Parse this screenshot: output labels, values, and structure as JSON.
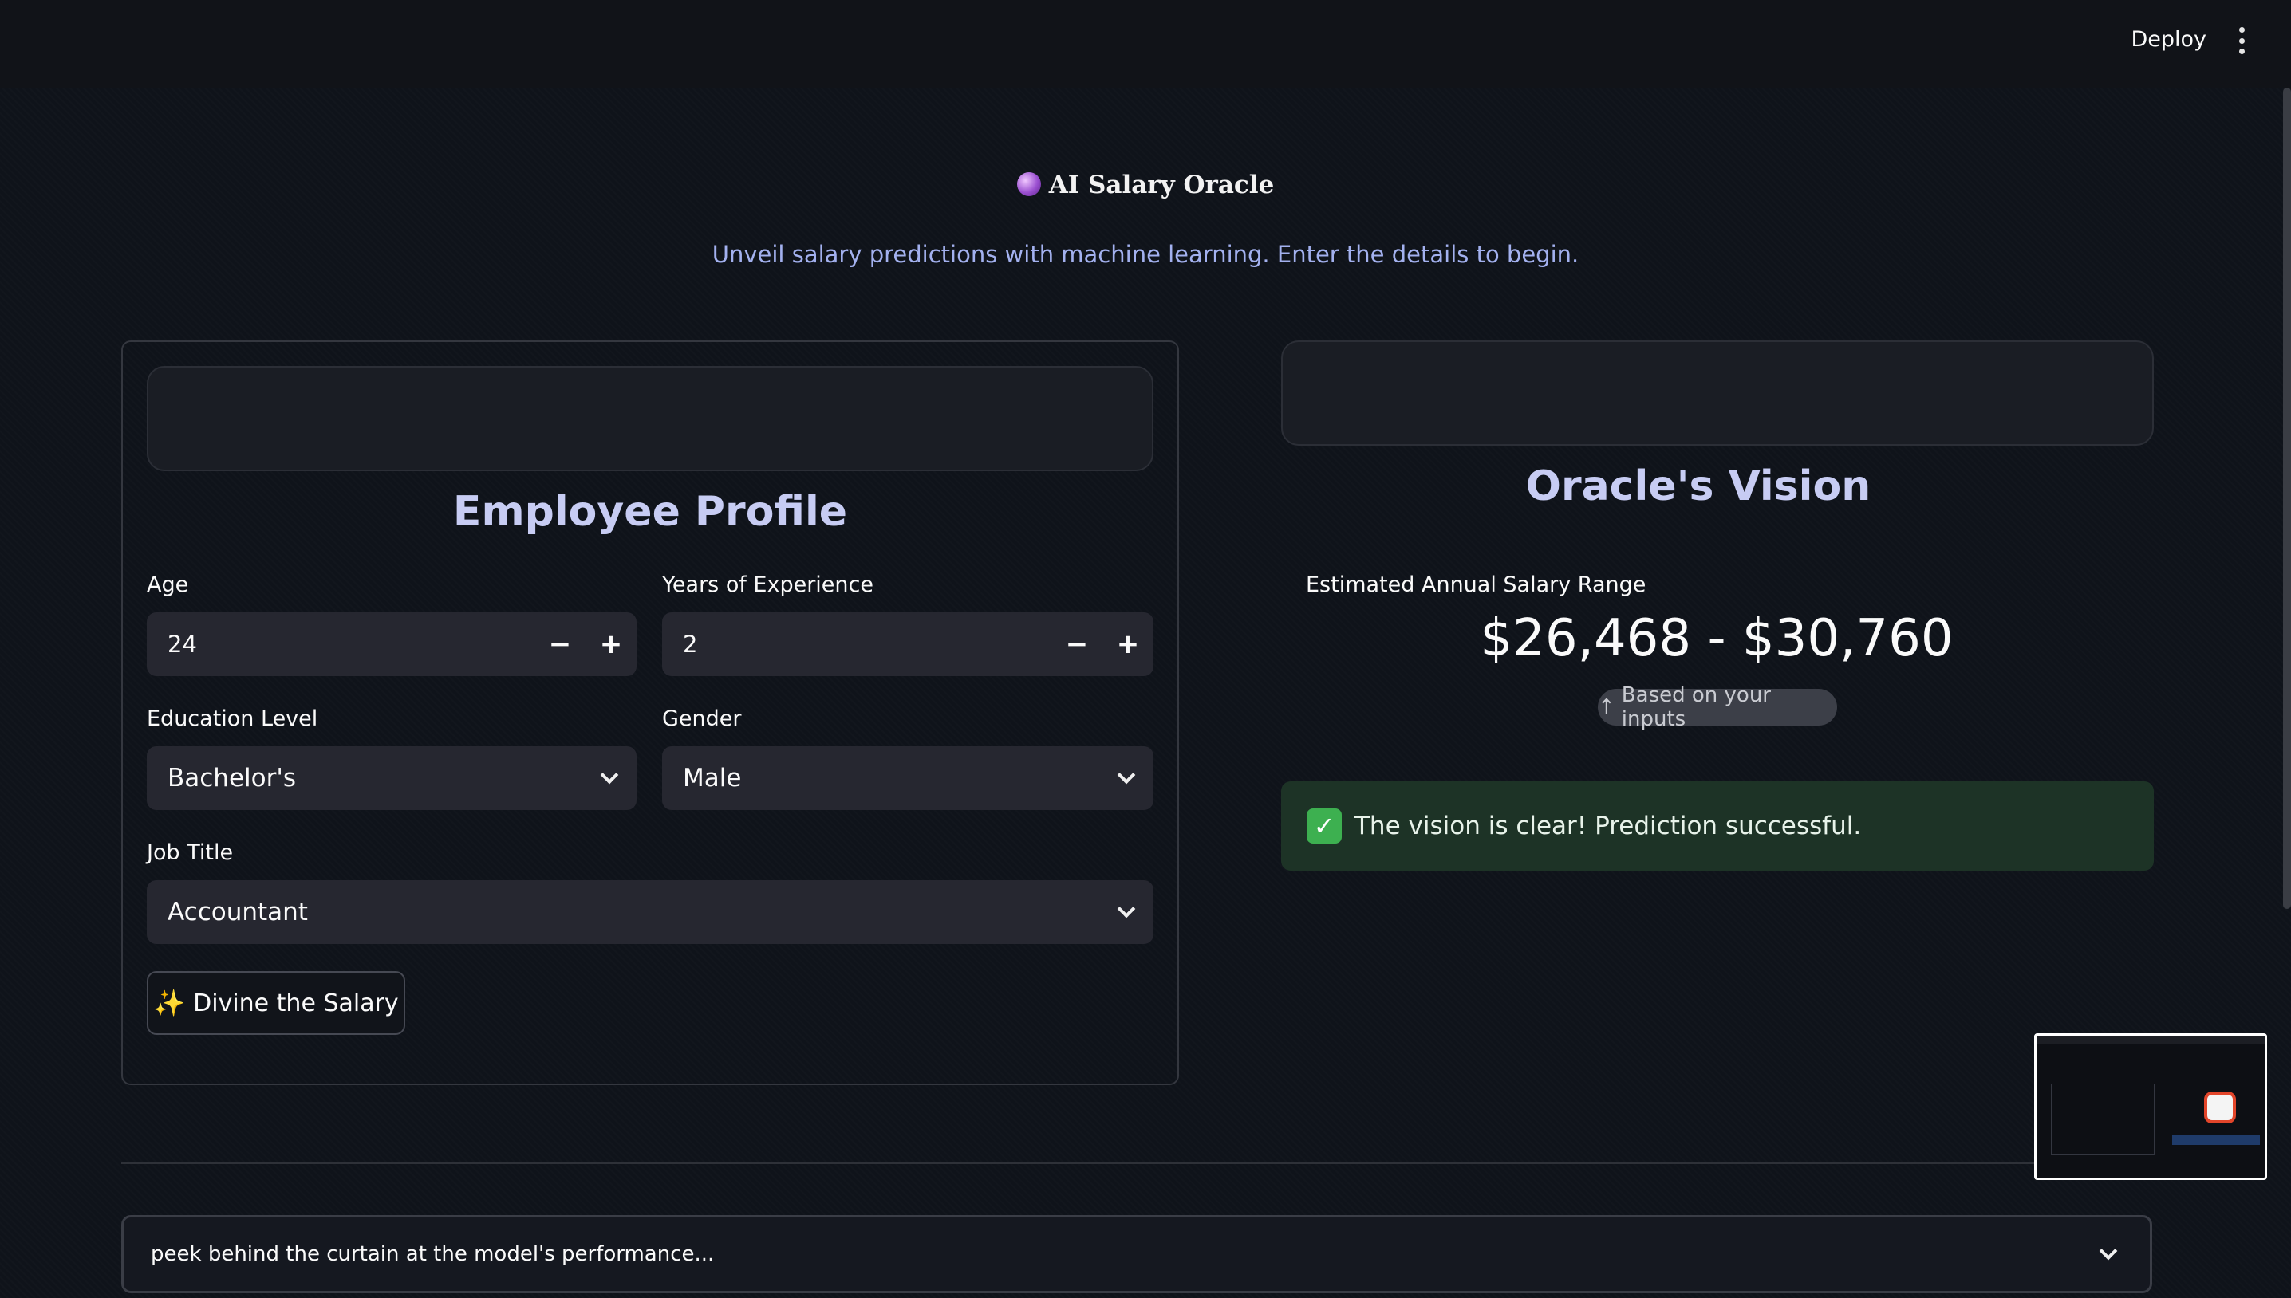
{
  "header": {
    "deploy_label": "Deploy",
    "menu_icon": "kebab-menu-icon"
  },
  "hero": {
    "title": "AI Salary Oracle",
    "title_icon": "crystal-ball-icon",
    "subtitle": "Unveil salary predictions with machine learning. Enter the details to begin."
  },
  "profile": {
    "heading": "Employee Profile",
    "age": {
      "label": "Age",
      "value": "24"
    },
    "experience": {
      "label": "Years of Experience",
      "value": "2"
    },
    "education": {
      "label": "Education Level",
      "value": "Bachelor's"
    },
    "gender": {
      "label": "Gender",
      "value": "Male"
    },
    "job_title": {
      "label": "Job Title",
      "value": "Accountant"
    },
    "submit_label": "Divine the Salary",
    "submit_icon": "sparkles-icon"
  },
  "vision": {
    "heading": "Oracle's Vision",
    "metric_label": "Estimated Annual Salary Range",
    "metric_value": "$26,468 - $30,760",
    "delta_text": "Based on your inputs",
    "success_message": "The vision is clear! Prediction successful.",
    "success_icon": "check-mark-icon"
  },
  "expander": {
    "label": "peek behind the curtain at the model's performance..."
  },
  "colors": {
    "accent_heading": "#c7ccf3",
    "subtitle": "#a3b1ef",
    "success_bg": "#1d3326",
    "background": "#0f131a"
  }
}
